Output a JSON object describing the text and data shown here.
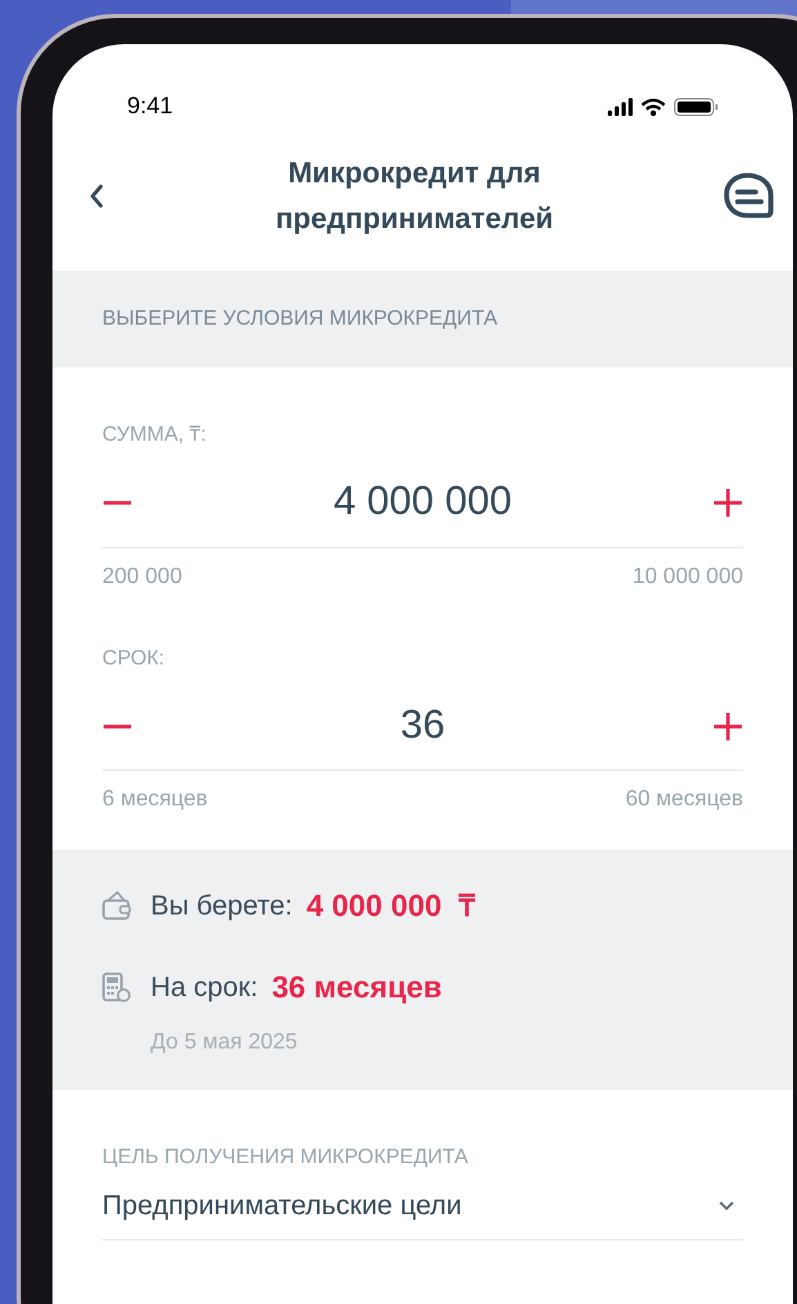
{
  "status_bar": {
    "time": "9:41"
  },
  "header": {
    "title": "Микрокредит для предпринимателей"
  },
  "section_title": "ВЫБЕРИТЕ УСЛОВИЯ МИКРОКРЕДИТА",
  "steppers": [
    {
      "label": "СУММА, ₸:",
      "value": "4 000 000",
      "min": "200 000",
      "max": "10 000 000"
    },
    {
      "label": "СРОК:",
      "value": "36",
      "min": "6 месяцев",
      "max": "60 месяцев"
    }
  ],
  "summary": [
    {
      "kind": "wallet",
      "label": "Вы берете:",
      "value": "4 000 000  ₸"
    },
    {
      "kind": "calculator",
      "label": "На срок:",
      "value": "36 месяцев",
      "note": "До 5 мая 2025"
    }
  ],
  "purpose": {
    "label": "ЦЕЛЬ ПОЛУЧЕНИЯ МИКРОКРЕДИТА",
    "value": "Предпринимательские цели"
  }
}
